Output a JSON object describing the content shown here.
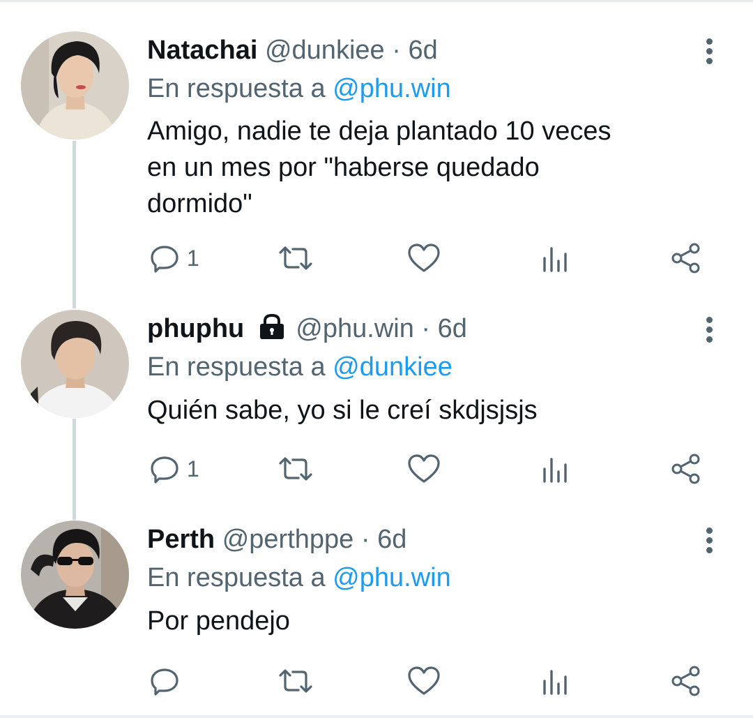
{
  "tweets": [
    {
      "name": "Natachai",
      "handle": "@dunkiee",
      "dot": "·",
      "time": "6d",
      "reply_prefix": "En respuesta a",
      "reply_to": "@phu.win",
      "lines": [
        "Amigo, nadie te deja plantado 10 veces",
        "en un mes por \"haberse quedado",
        "dormido\""
      ],
      "reply_count": "1",
      "locked": false,
      "avatar_colors": {
        "bg": "#d9d2c8",
        "face": "#e9c8ae",
        "hair": "#1c1a1a",
        "shirt": "#ece4d6"
      }
    },
    {
      "name": "phuphu",
      "handle": "@phu.win",
      "dot": "·",
      "time": "6d",
      "reply_prefix": "En respuesta a",
      "reply_to": "@dunkiee",
      "lines": [
        "Quién sabe, yo si le creí skdjsjsjs"
      ],
      "reply_count": "1",
      "locked": true,
      "avatar_colors": {
        "bg": "#cfc7bd",
        "face": "#e4c1a5",
        "hair": "#2a2522",
        "shirt": "#f3f3f3"
      }
    },
    {
      "name": "Perth",
      "handle": "@perthppe",
      "dot": "·",
      "time": "6d",
      "reply_prefix": "En respuesta a",
      "reply_to": "@phu.win",
      "lines": [
        "Por pendejo"
      ],
      "reply_count": "",
      "locked": false,
      "avatar_colors": {
        "bg": "#b7b2ab",
        "face": "#dcb9a0",
        "hair": "#171515",
        "shirt": "#1e1c1c"
      }
    }
  ],
  "icons": {
    "reply": "speech-bubble-icon",
    "retweet": "retweet-icon",
    "like": "heart-icon",
    "stats": "bar-chart-icon",
    "share": "share-icon",
    "more": "vertical-dots-icon",
    "lock": "lock-icon"
  },
  "colors": {
    "text": "#0f1419",
    "secondary": "#536471",
    "link": "#1d9bf0",
    "thread_line": "#cfd9de"
  }
}
